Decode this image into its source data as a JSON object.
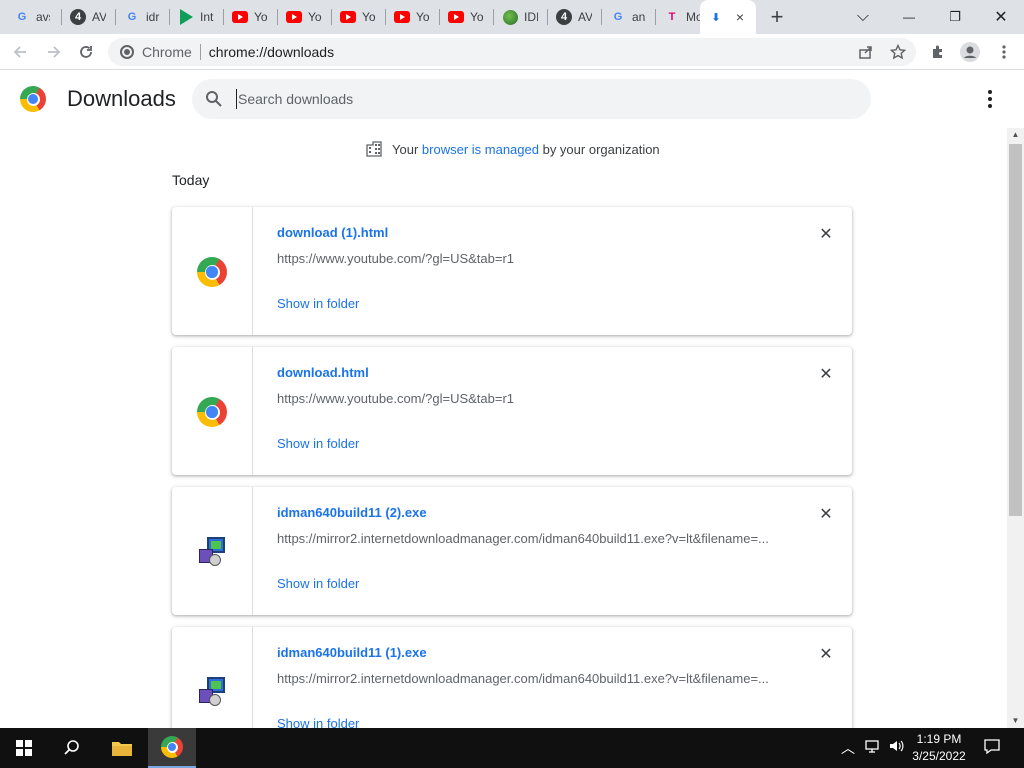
{
  "tabs": [
    {
      "title": "avs",
      "favicon": "google-g-icon"
    },
    {
      "title": "AV",
      "favicon": "number-4-icon"
    },
    {
      "title": "idr",
      "favicon": "google-g-icon"
    },
    {
      "title": "Int",
      "favicon": "play-icon"
    },
    {
      "title": "Yo",
      "favicon": "youtube-icon"
    },
    {
      "title": "Yo",
      "favicon": "youtube-icon"
    },
    {
      "title": "Yo",
      "favicon": "youtube-icon"
    },
    {
      "title": "Yo",
      "favicon": "youtube-icon"
    },
    {
      "title": "Yo",
      "favicon": "youtube-icon"
    },
    {
      "title": "IDI",
      "favicon": "globe-icon"
    },
    {
      "title": "AV",
      "favicon": "number-4-icon"
    },
    {
      "title": "an",
      "favicon": "google-g-icon"
    },
    {
      "title": "Mo",
      "favicon": "t-mobile-icon"
    }
  ],
  "active_tab": {
    "favicon": "download-icon",
    "close": "×"
  },
  "new_tab": "+",
  "window": {
    "dropdown": "⌵",
    "minimize": "—",
    "restore": "❐",
    "close": "✕"
  },
  "omnibox": {
    "chrome_label": "Chrome",
    "url": "chrome://downloads"
  },
  "header": {
    "title": "Downloads",
    "search_placeholder": "Search downloads"
  },
  "managed": {
    "pre": "Your",
    "link": "browser is managed",
    "post": "by your organization"
  },
  "section_label": "Today",
  "downloads": [
    {
      "name": "download (1).html",
      "url": "https://www.youtube.com/?gl=US&tab=r1",
      "action": "Show in folder",
      "icon": "chrome-icon"
    },
    {
      "name": "download.html",
      "url": "https://www.youtube.com/?gl=US&tab=r1",
      "action": "Show in folder",
      "icon": "chrome-icon"
    },
    {
      "name": "idman640build11 (2).exe",
      "url": "https://mirror2.internetdownloadmanager.com/idman640build11.exe?v=lt&filename=...",
      "action": "Show in folder",
      "icon": "exe-installer-icon"
    },
    {
      "name": "idman640build11 (1).exe",
      "url": "https://mirror2.internetdownloadmanager.com/idman640build11.exe?v=lt&filename=...",
      "action": "Show in folder",
      "icon": "exe-installer-icon"
    }
  ],
  "remove_glyph": "✕",
  "taskbar": {
    "time": "1:19 PM",
    "date": "3/25/2022"
  },
  "colors": {
    "link": "#1a73e8",
    "tabstrip": "#dee1e6",
    "taskbar": "#101010"
  }
}
